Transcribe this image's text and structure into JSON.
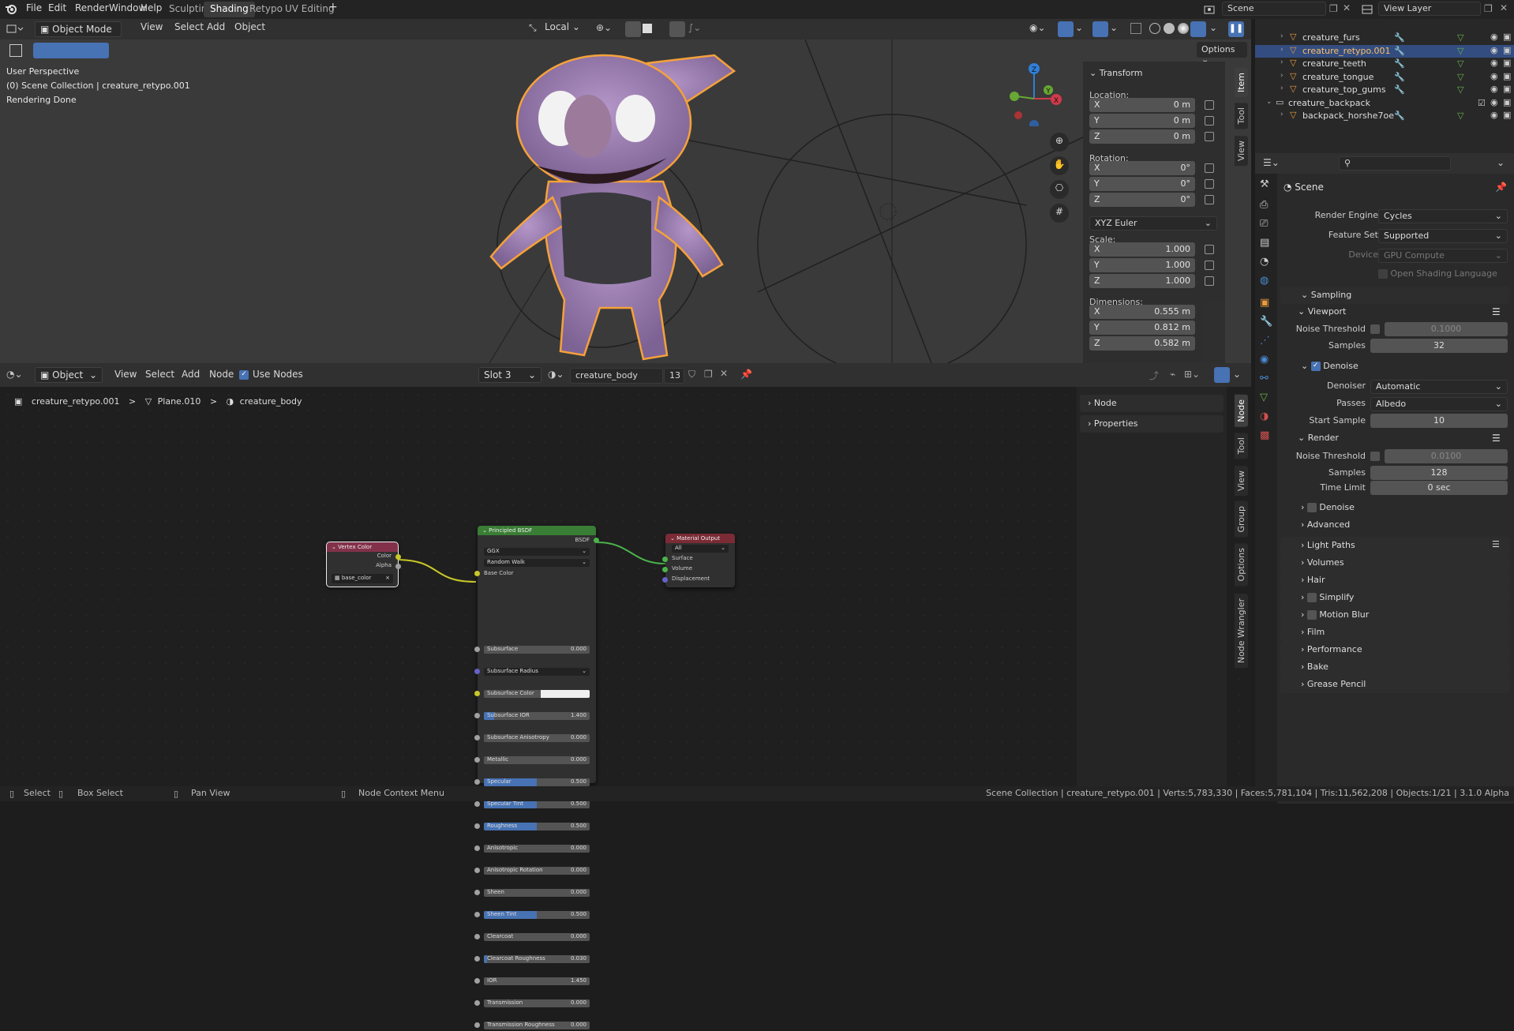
{
  "topbar": {
    "menus": [
      "File",
      "Edit",
      "Render",
      "Window",
      "Help"
    ],
    "workspaces": [
      "Sculpting",
      "Shading",
      "Retypo",
      "UV Editing"
    ],
    "active_workspace": "Shading",
    "add_tab": "+",
    "scene": "Scene",
    "view_layer": "View Layer"
  },
  "viewport": {
    "mode": "Object Mode",
    "menus": [
      "View",
      "Select",
      "Add",
      "Object"
    ],
    "transform_orientation": "Local",
    "options": "Options",
    "overlay_text": [
      "User Perspective",
      "(0) Scene Collection | creature_retypo.001",
      "Rendering Done"
    ],
    "gizmo_axes": {
      "z": "Z",
      "y": "Y",
      "x": "X"
    },
    "npanel": {
      "title": "Transform",
      "location_label": "Location:",
      "location": [
        {
          "axis": "X",
          "value": "0 m"
        },
        {
          "axis": "Y",
          "value": "0 m"
        },
        {
          "axis": "Z",
          "value": "0 m"
        }
      ],
      "rotation_label": "Rotation:",
      "rotation": [
        {
          "axis": "X",
          "value": "0°"
        },
        {
          "axis": "Y",
          "value": "0°"
        },
        {
          "axis": "Z",
          "value": "0°"
        }
      ],
      "rotation_mode": "XYZ Euler",
      "scale_label": "Scale:",
      "scale": [
        {
          "axis": "X",
          "value": "1.000"
        },
        {
          "axis": "Y",
          "value": "1.000"
        },
        {
          "axis": "Z",
          "value": "1.000"
        }
      ],
      "dimensions_label": "Dimensions:",
      "dimensions": [
        {
          "axis": "X",
          "value": "0.555 m"
        },
        {
          "axis": "Y",
          "value": "0.812 m"
        },
        {
          "axis": "Z",
          "value": "0.582 m"
        }
      ]
    },
    "side_tabs": [
      "Item",
      "Tool",
      "View"
    ]
  },
  "node_editor": {
    "type": "Object",
    "menus": [
      "View",
      "Select",
      "Add",
      "Node"
    ],
    "use_nodes": "Use Nodes",
    "slot": "Slot 3",
    "material": "creature_body",
    "users": "13",
    "breadcrumb": [
      "creature_retypo.001",
      "Plane.010",
      "creature_body"
    ],
    "breadcrumb_sep": ">",
    "npanel_sections": [
      "Node",
      "Properties"
    ],
    "side_tabs": [
      "Node",
      "Tool",
      "View",
      "Group",
      "Options",
      "Node Wrangler"
    ],
    "vertex_color": {
      "title": "Vertex Color",
      "outputs": [
        "Color",
        "Alpha"
      ],
      "layer": "base_color",
      "clear": "×"
    },
    "bsdf": {
      "title": "Principled BSDF",
      "output": "BSDF",
      "distribution": "GGX",
      "subsurface_method": "Random Walk",
      "base_color": "Base Color",
      "inputs": [
        {
          "label": "Subsurface",
          "value": "0.000",
          "fill": 0
        },
        {
          "label": "Subsurface Radius",
          "value": "",
          "fill": 0,
          "dropdown": true
        },
        {
          "label": "Subsurface Color",
          "value": "",
          "fill": 0,
          "color": "#f0f0f0"
        },
        {
          "label": "Subsurface IOR",
          "value": "1.400",
          "fill": 0.1
        },
        {
          "label": "Subsurface Anisotropy",
          "value": "0.000",
          "fill": 0
        },
        {
          "label": "Metallic",
          "value": "0.000",
          "fill": 0
        },
        {
          "label": "Specular",
          "value": "0.500",
          "fill": 0.5
        },
        {
          "label": "Specular Tint",
          "value": "0.500",
          "fill": 0.5
        },
        {
          "label": "Roughness",
          "value": "0.500",
          "fill": 0.5
        },
        {
          "label": "Anisotropic",
          "value": "0.000",
          "fill": 0
        },
        {
          "label": "Anisotropic Rotation",
          "value": "0.000",
          "fill": 0
        },
        {
          "label": "Sheen",
          "value": "0.000",
          "fill": 0
        },
        {
          "label": "Sheen Tint",
          "value": "0.500",
          "fill": 0.5
        },
        {
          "label": "Clearcoat",
          "value": "0.000",
          "fill": 0
        },
        {
          "label": "Clearcoat Roughness",
          "value": "0.030",
          "fill": 0.03
        },
        {
          "label": "IOR",
          "value": "1.450",
          "fill": 0
        },
        {
          "label": "Transmission",
          "value": "0.000",
          "fill": 0
        },
        {
          "label": "Transmission Roughness",
          "value": "0.000",
          "fill": 0
        }
      ]
    },
    "output": {
      "title": "Material Output",
      "target": "All",
      "inputs": [
        "Surface",
        "Volume",
        "Displacement"
      ]
    }
  },
  "outliner": {
    "rows": [
      {
        "name": "creature_furs",
        "selected": false,
        "indent": 1
      },
      {
        "name": "creature_retypo.001",
        "selected": true,
        "indent": 1
      },
      {
        "name": "creature_teeth",
        "selected": false,
        "indent": 1
      },
      {
        "name": "creature_tongue",
        "selected": false,
        "indent": 1
      },
      {
        "name": "creature_top_gums",
        "selected": false,
        "indent": 1
      },
      {
        "name": "creature_backpack",
        "selected": false,
        "indent": 0
      },
      {
        "name": "backpack_horshe7oe",
        "selected": false,
        "indent": 1
      }
    ]
  },
  "properties": {
    "context": "Scene",
    "render_engine_label": "Render Engine",
    "render_engine": "Cycles",
    "feature_set_label": "Feature Set",
    "feature_set": "Supported",
    "device_label": "Device",
    "device": "GPU Compute",
    "osl": "Open Shading Language",
    "sampling": "Sampling",
    "viewport": "Viewport",
    "noise_threshold_label": "Noise Threshold",
    "vp_noise_threshold": "0.1000",
    "samples_label": "Samples",
    "vp_samples": "32",
    "denoise": "Denoise",
    "denoiser_label": "Denoiser",
    "denoiser": "Automatic",
    "passes_label": "Passes",
    "passes": "Albedo",
    "start_sample_label": "Start Sample",
    "start_sample": "10",
    "render": "Render",
    "r_noise_threshold": "0.0100",
    "r_samples": "128",
    "time_limit_label": "Time Limit",
    "time_limit": "0 sec",
    "r_denoise": "Denoise",
    "advanced": "Advanced",
    "sections": [
      "Light Paths",
      "Volumes",
      "Hair",
      "Simplify",
      "Motion Blur",
      "Film",
      "Performance",
      "Bake",
      "Grease Pencil"
    ]
  },
  "status": {
    "select": "Select",
    "box_select": "Box Select",
    "pan": "Pan View",
    "context": "Node Context Menu",
    "info": "Scene Collection | creature_retypo.001 | Verts:5,783,330 | Faces:5,781,104 | Tris:11,562,208 | Objects:1/21 | 3.1.0 Alpha"
  }
}
